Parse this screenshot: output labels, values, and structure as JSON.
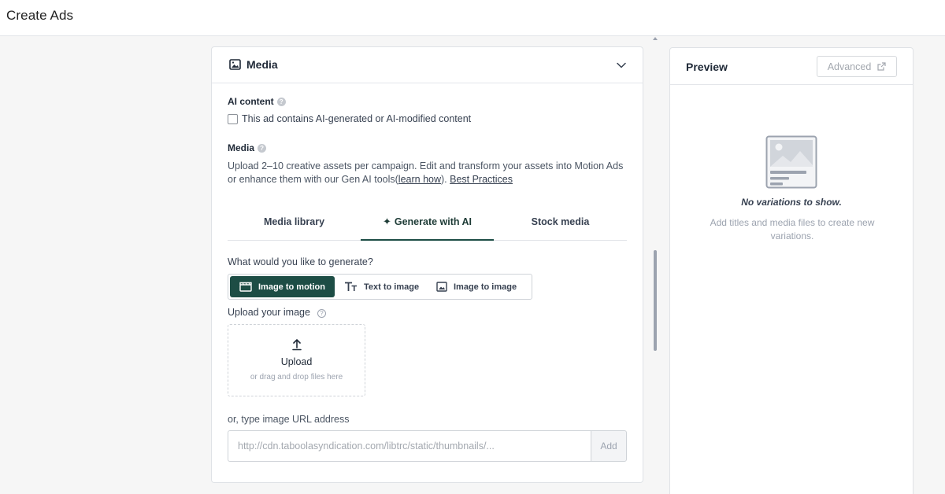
{
  "page": {
    "title": "Create Ads"
  },
  "media_card": {
    "title": "Media",
    "ai_content": {
      "label": "AI content",
      "help": "?",
      "checkbox_label": "This ad contains AI-generated or AI-modified content",
      "checked": false
    },
    "media": {
      "label": "Media",
      "help": "?",
      "description": "Upload 2–10 creative assets per campaign. Edit and transform your assets into Motion Ads or enhance them with our Gen AI tools",
      "learn_open": "(",
      "learn_link": "learn how",
      "learn_close": "). ",
      "best_practices_link": "Best Practices"
    },
    "tabs": [
      {
        "label": "Media library",
        "active": false
      },
      {
        "label": "Generate with AI",
        "active": true,
        "icon": "sparkle-icon"
      },
      {
        "label": "Stock media",
        "active": false
      }
    ],
    "generate": {
      "question": "What would you like to generate?",
      "options": [
        {
          "label": "Image to motion",
          "icon": "clapperboard-icon",
          "active": true
        },
        {
          "label": "Text to image",
          "icon": "text-size-icon",
          "active": false
        },
        {
          "label": "Image to image",
          "icon": "image-icon",
          "active": false
        }
      ]
    },
    "upload": {
      "label": "Upload your image",
      "help": "?",
      "title": "Upload",
      "subtitle": "or drag and drop files here"
    },
    "url": {
      "label": "or, type image URL address",
      "placeholder": "http://cdn.taboolasyndication.com/libtrc/static/thumbnails/...",
      "value": "",
      "add_label": "Add"
    }
  },
  "preview": {
    "title": "Preview",
    "advanced_label": "Advanced",
    "empty_title": "No variations to show.",
    "empty_subtitle": "Add titles and media files to create new variations."
  },
  "colors": {
    "accent": "#1d4d45",
    "border": "#dfe2e6",
    "background": "#f6f6f6"
  }
}
